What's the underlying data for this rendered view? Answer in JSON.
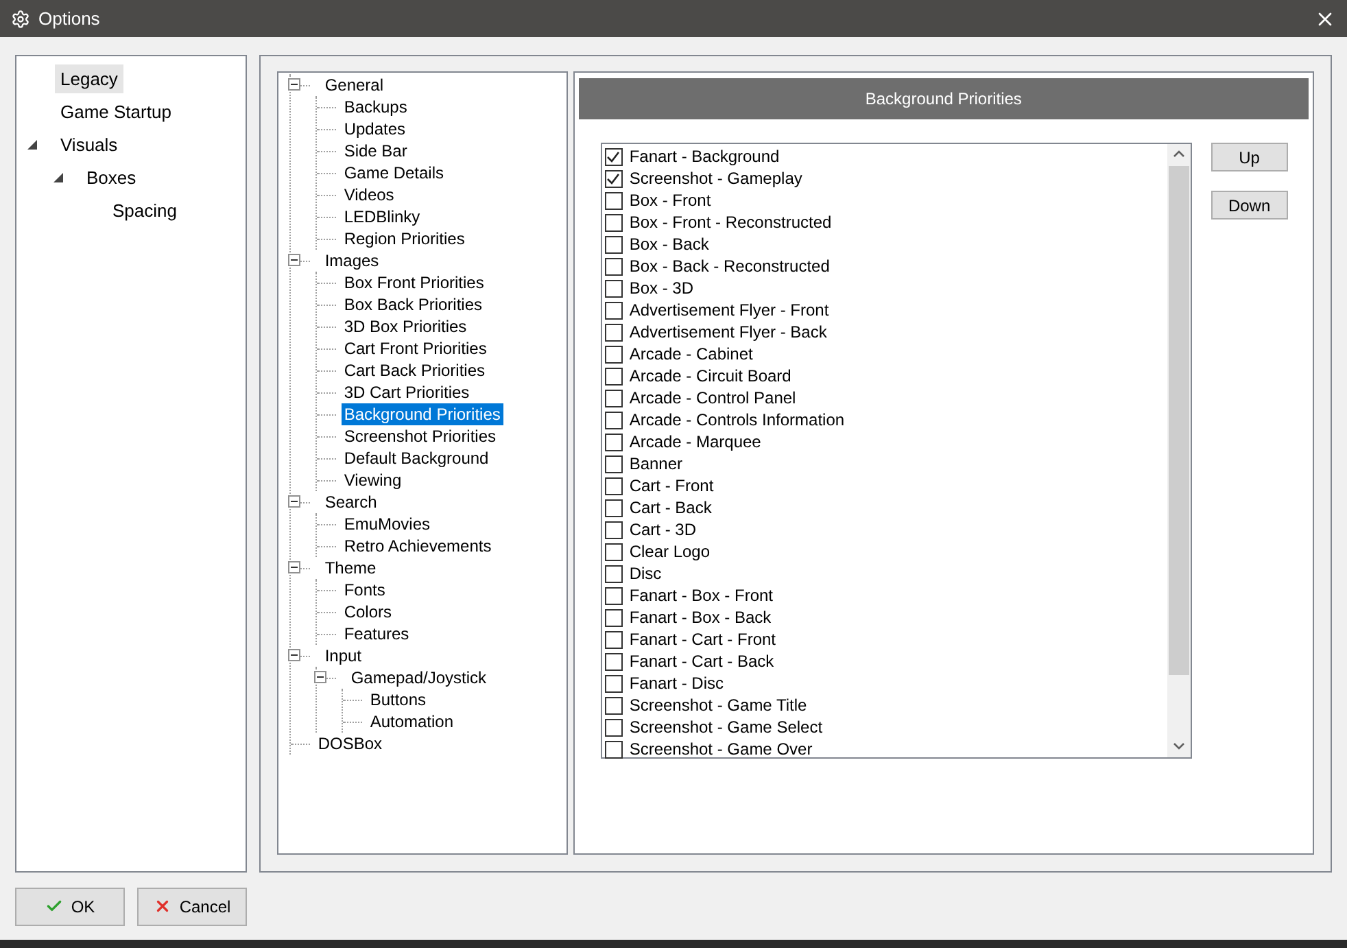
{
  "window": {
    "title": "Options"
  },
  "left_tree": {
    "items": [
      {
        "label": "Legacy",
        "selected": true
      },
      {
        "label": "Game Startup",
        "selected": false
      },
      {
        "label": "Visuals",
        "selected": false,
        "expanded": true,
        "children": [
          {
            "label": "Boxes",
            "selected": false,
            "expanded": true,
            "children": [
              {
                "label": "Spacing",
                "selected": false
              }
            ]
          }
        ]
      }
    ]
  },
  "settings_tree": {
    "items": [
      {
        "label": "General",
        "selected": false,
        "expanded": true,
        "children": [
          {
            "label": "Backups",
            "selected": false
          },
          {
            "label": "Updates",
            "selected": false
          },
          {
            "label": "Side Bar",
            "selected": false
          },
          {
            "label": "Game Details",
            "selected": false
          },
          {
            "label": "Videos",
            "selected": false
          },
          {
            "label": "LEDBlinky",
            "selected": false
          },
          {
            "label": "Region Priorities",
            "selected": false
          }
        ]
      },
      {
        "label": "Images",
        "selected": false,
        "expanded": true,
        "children": [
          {
            "label": "Box Front Priorities",
            "selected": false
          },
          {
            "label": "Box Back Priorities",
            "selected": false
          },
          {
            "label": "3D Box Priorities",
            "selected": false
          },
          {
            "label": "Cart Front Priorities",
            "selected": false
          },
          {
            "label": "Cart Back Priorities",
            "selected": false
          },
          {
            "label": "3D Cart Priorities",
            "selected": false
          },
          {
            "label": "Background Priorities",
            "selected": true
          },
          {
            "label": "Screenshot Priorities",
            "selected": false
          },
          {
            "label": "Default Background",
            "selected": false
          },
          {
            "label": "Viewing",
            "selected": false
          }
        ]
      },
      {
        "label": "Search",
        "selected": false,
        "expanded": true,
        "children": [
          {
            "label": "EmuMovies",
            "selected": false
          },
          {
            "label": "Retro Achievements",
            "selected": false
          }
        ]
      },
      {
        "label": "Theme",
        "selected": false,
        "expanded": true,
        "children": [
          {
            "label": "Fonts",
            "selected": false
          },
          {
            "label": "Colors",
            "selected": false
          },
          {
            "label": "Features",
            "selected": false
          }
        ]
      },
      {
        "label": "Input",
        "selected": false,
        "expanded": true,
        "children": [
          {
            "label": "Gamepad/Joystick",
            "selected": false,
            "expanded": true,
            "children": [
              {
                "label": "Buttons",
                "selected": false
              },
              {
                "label": "Automation",
                "selected": false
              }
            ]
          }
        ]
      },
      {
        "label": "DOSBox",
        "selected": false
      }
    ]
  },
  "panel": {
    "title": "Background Priorities",
    "items": [
      {
        "label": "Fanart - Background",
        "checked": true
      },
      {
        "label": "Screenshot - Gameplay",
        "checked": true
      },
      {
        "label": "Box - Front",
        "checked": false
      },
      {
        "label": "Box - Front - Reconstructed",
        "checked": false
      },
      {
        "label": "Box - Back",
        "checked": false
      },
      {
        "label": "Box - Back - Reconstructed",
        "checked": false
      },
      {
        "label": "Box - 3D",
        "checked": false
      },
      {
        "label": "Advertisement Flyer - Front",
        "checked": false
      },
      {
        "label": "Advertisement Flyer - Back",
        "checked": false
      },
      {
        "label": "Arcade - Cabinet",
        "checked": false
      },
      {
        "label": "Arcade - Circuit Board",
        "checked": false
      },
      {
        "label": "Arcade - Control Panel",
        "checked": false
      },
      {
        "label": "Arcade - Controls Information",
        "checked": false
      },
      {
        "label": "Arcade - Marquee",
        "checked": false
      },
      {
        "label": "Banner",
        "checked": false
      },
      {
        "label": "Cart - Front",
        "checked": false
      },
      {
        "label": "Cart - Back",
        "checked": false
      },
      {
        "label": "Cart - 3D",
        "checked": false
      },
      {
        "label": "Clear Logo",
        "checked": false
      },
      {
        "label": "Disc",
        "checked": false
      },
      {
        "label": "Fanart - Box - Front",
        "checked": false
      },
      {
        "label": "Fanart - Box - Back",
        "checked": false
      },
      {
        "label": "Fanart - Cart - Front",
        "checked": false
      },
      {
        "label": "Fanart - Cart - Back",
        "checked": false
      },
      {
        "label": "Fanart - Disc",
        "checked": false
      },
      {
        "label": "Screenshot - Game Title",
        "checked": false
      },
      {
        "label": "Screenshot - Game Select",
        "checked": false
      },
      {
        "label": "Screenshot - Game Over",
        "checked": false
      }
    ],
    "buttons": [
      "Up",
      "Down"
    ]
  },
  "footer": {
    "buttons": [
      {
        "kind": "ok",
        "label": "OK"
      },
      {
        "kind": "cancel",
        "label": "Cancel"
      }
    ]
  }
}
